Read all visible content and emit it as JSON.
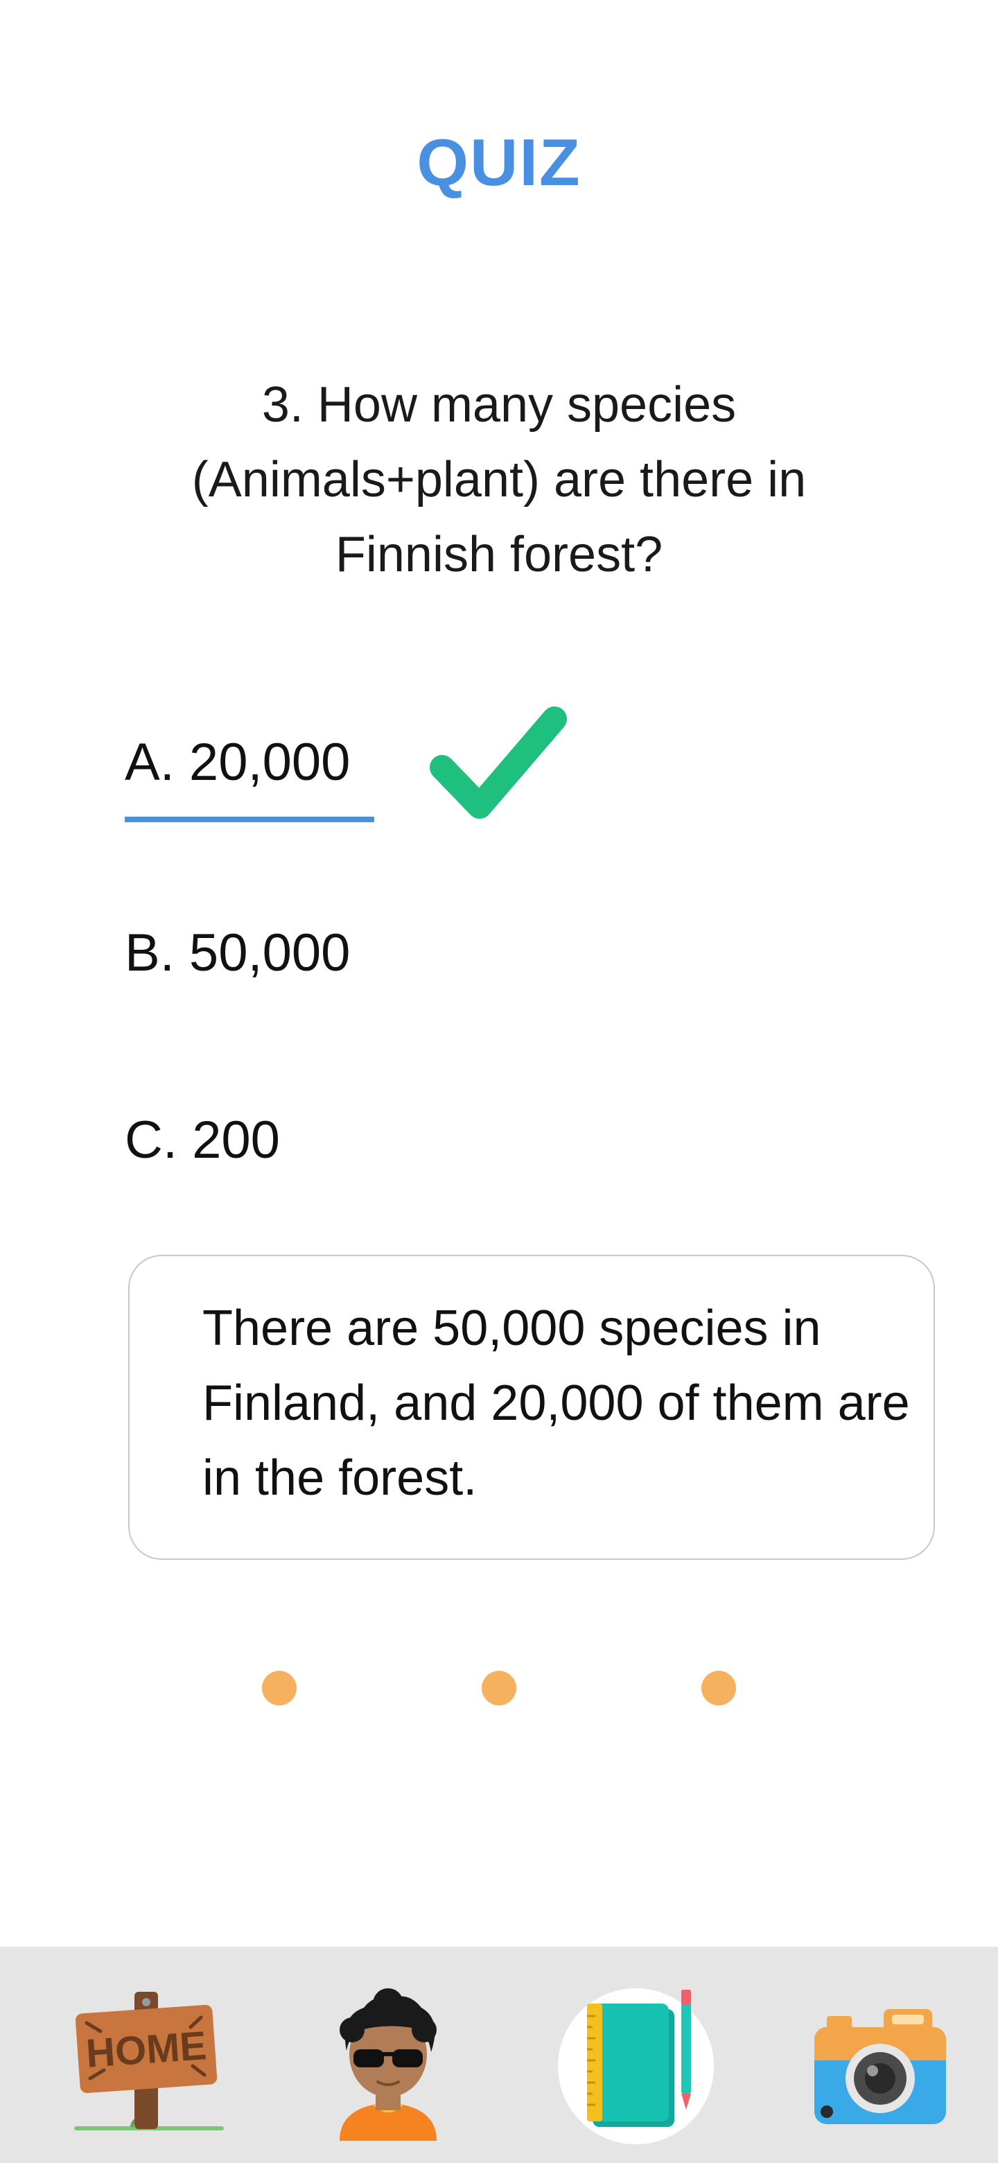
{
  "header": {
    "title": "QUIZ"
  },
  "question": {
    "text": "3. How many species (Animals+plant) are there in Finnish forest?"
  },
  "options": [
    {
      "label": "A. 20,000",
      "selected": true,
      "correct": true
    },
    {
      "label": "B. 50,000",
      "selected": false,
      "correct": false
    },
    {
      "label": "C. 200",
      "selected": false,
      "correct": false
    }
  ],
  "explanation": {
    "text": "There are 50,000 species in Finland, and 20,000 of them are in the forest."
  },
  "pagination": {
    "count": 3,
    "color": "#f6b15e"
  },
  "tabbar": {
    "items": [
      {
        "icon": "home-sign-icon",
        "sign_text": "HOME",
        "active": false
      },
      {
        "icon": "profile-avatar-icon",
        "active": false
      },
      {
        "icon": "notebook-icon",
        "active": true
      },
      {
        "icon": "camera-icon",
        "active": false
      }
    ]
  },
  "colors": {
    "accent": "#4a90e2",
    "correct": "#1fbf7f",
    "dot": "#f6b15e",
    "tabbar_bg": "#e5e5e5"
  }
}
